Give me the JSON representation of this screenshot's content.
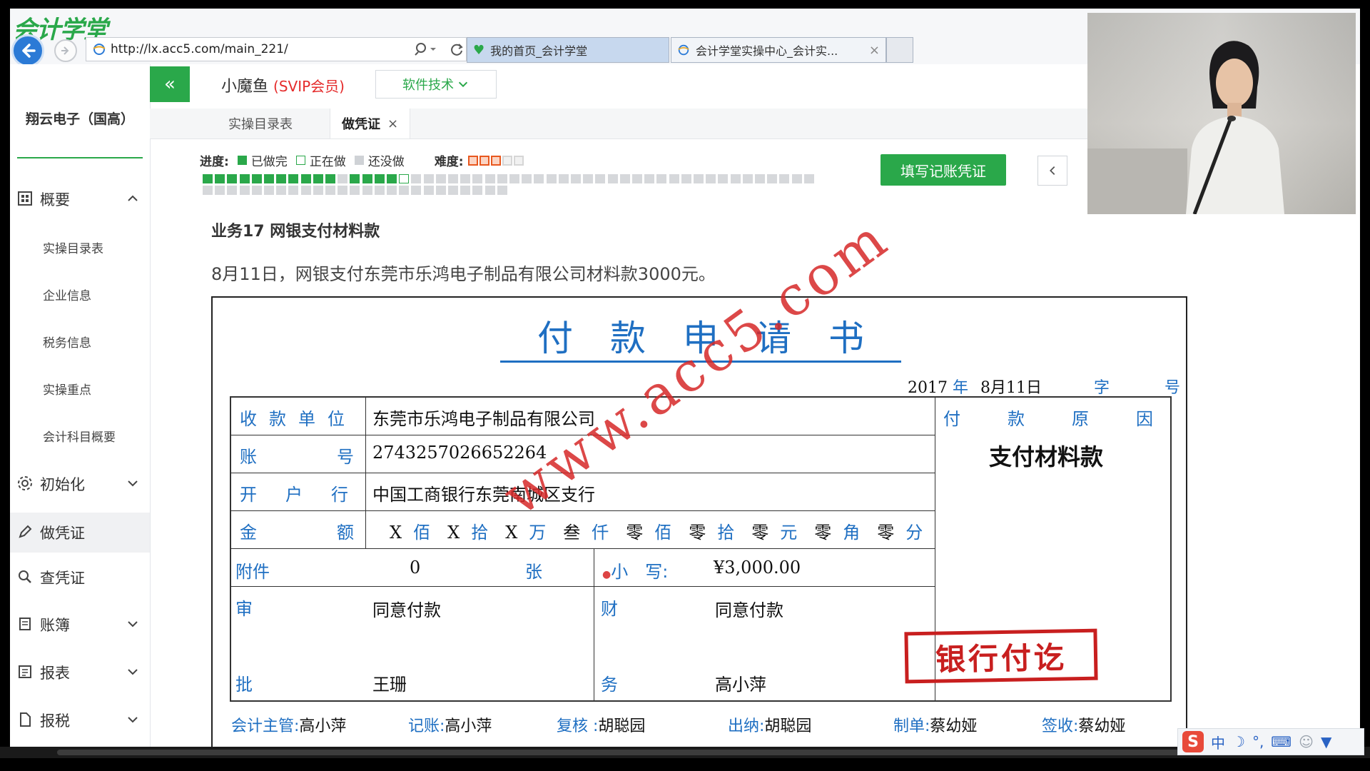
{
  "browser": {
    "logo_text": "会计学堂",
    "url": "http://lx.acc5.com/main_221/",
    "tabs": [
      {
        "label": "我的首页_会计学堂"
      },
      {
        "label": "会计学堂实操中心_会计实..."
      }
    ],
    "close_glyph": "×"
  },
  "sidebar": {
    "company": "翔云电子（国高）",
    "menu": [
      {
        "label": "概要",
        "icon": "grid-icon"
      },
      {
        "label": "初始化",
        "icon": "gear-icon"
      },
      {
        "label": "做凭证",
        "icon": "pen-icon"
      },
      {
        "label": "查凭证",
        "icon": "search-icon"
      },
      {
        "label": "账簿",
        "icon": "book-icon"
      },
      {
        "label": "报表",
        "icon": "report-icon"
      },
      {
        "label": "报税",
        "icon": "document-icon"
      }
    ],
    "submenu": [
      "实操目录表",
      "企业信息",
      "税务信息",
      "实操重点",
      "会计科目概要"
    ]
  },
  "header": {
    "collapse_glyph": "«",
    "user_name": "小魔鱼",
    "user_badge": "(SVIP会员)",
    "tech_button": "软件技术"
  },
  "subtabs": [
    {
      "label": "实操目录表"
    },
    {
      "label": "做凭证"
    }
  ],
  "progress": {
    "label": "进度:",
    "legend_done": "已做完",
    "legend_doing": "正在做",
    "legend_todo": "还没做",
    "difficulty_label": "难度:",
    "difficulty_stars": 3,
    "difficulty_max": 5,
    "total": 75,
    "cells": [
      "d",
      "d",
      "d",
      "d",
      "d",
      "d",
      "d",
      "d",
      "d",
      "d",
      "d",
      "t",
      "d",
      "d",
      "d",
      "d",
      "c",
      "t",
      "t",
      "t",
      "t",
      "t",
      "t",
      "t",
      "t",
      "t",
      "t",
      "t",
      "t",
      "t",
      "t",
      "t",
      "t",
      "t",
      "t",
      "t",
      "t",
      "t",
      "t",
      "t",
      "t",
      "t",
      "t",
      "t",
      "t",
      "t",
      "t",
      "t",
      "t",
      "t",
      "t",
      "t",
      "t",
      "t",
      "t",
      "t",
      "t",
      "t",
      "t",
      "t",
      "t",
      "t",
      "t",
      "t",
      "t",
      "t",
      "t",
      "t",
      "t",
      "t",
      "t",
      "t",
      "t",
      "t",
      "t"
    ],
    "colors": {
      "done": "#2aa84a",
      "doing": "#ffffff",
      "todo": "#d6d8db"
    }
  },
  "actions": {
    "fill_voucher": "填写记账凭证"
  },
  "business": {
    "title": "业务17 网银支付材料款",
    "description": "8月11日，网银支付东莞市乐鸿电子制品有限公司材料款3000元。"
  },
  "voucher": {
    "title": "付款申请书",
    "date_year": "2017",
    "date_year_label": "年",
    "date_md": "8月11日",
    "zi_label": "字",
    "hao_label": "号",
    "payee_label": "收款单位",
    "payee": "东莞市乐鸿电子制品有限公司",
    "account_label": "账号",
    "account": "2743257026652264",
    "bank_label": "开户行",
    "bank": "中国工商银行东莞南城区支行",
    "amount_label": "金额",
    "amount_chinese": [
      {
        "v": "X",
        "u": "佰"
      },
      {
        "v": "X",
        "u": "拾"
      },
      {
        "v": "X",
        "u": "万"
      },
      {
        "v": "叁",
        "u": "仟"
      },
      {
        "v": "零",
        "u": "佰"
      },
      {
        "v": "零",
        "u": "拾"
      },
      {
        "v": "零",
        "u": "元"
      },
      {
        "v": "零",
        "u": "角"
      },
      {
        "v": "零",
        "u": "分"
      }
    ],
    "attachment_label": "附件",
    "attachment_count": "0",
    "attachment_unit": "张",
    "small_amount_label": "小　写:",
    "small_amount": "¥3,000.00",
    "approve_label_top": "审",
    "approve_label_bottom": "批",
    "approve_opinion": "同意付款",
    "approver": "王珊",
    "finance_label_top": "财",
    "finance_label_bottom": "务",
    "finance_opinion": "同意付款",
    "finance_person": "高小萍",
    "reason_label": "付款原因",
    "reason": "支付材料款",
    "stamp_text": "银行付讫",
    "watermark_text": "www.acc5.com",
    "signers": [
      {
        "role": "会计主管:",
        "name": "高小萍"
      },
      {
        "role": "记账:",
        "name": "高小萍"
      },
      {
        "role": "复核 :",
        "name": "胡聪园"
      },
      {
        "role": "出纳:",
        "name": "胡聪园"
      },
      {
        "role": "制单:",
        "name": "蔡幼娅"
      },
      {
        "role": "签收:",
        "name": "蔡幼娅"
      }
    ]
  },
  "ime": {
    "logo": "S",
    "mode": "中"
  }
}
